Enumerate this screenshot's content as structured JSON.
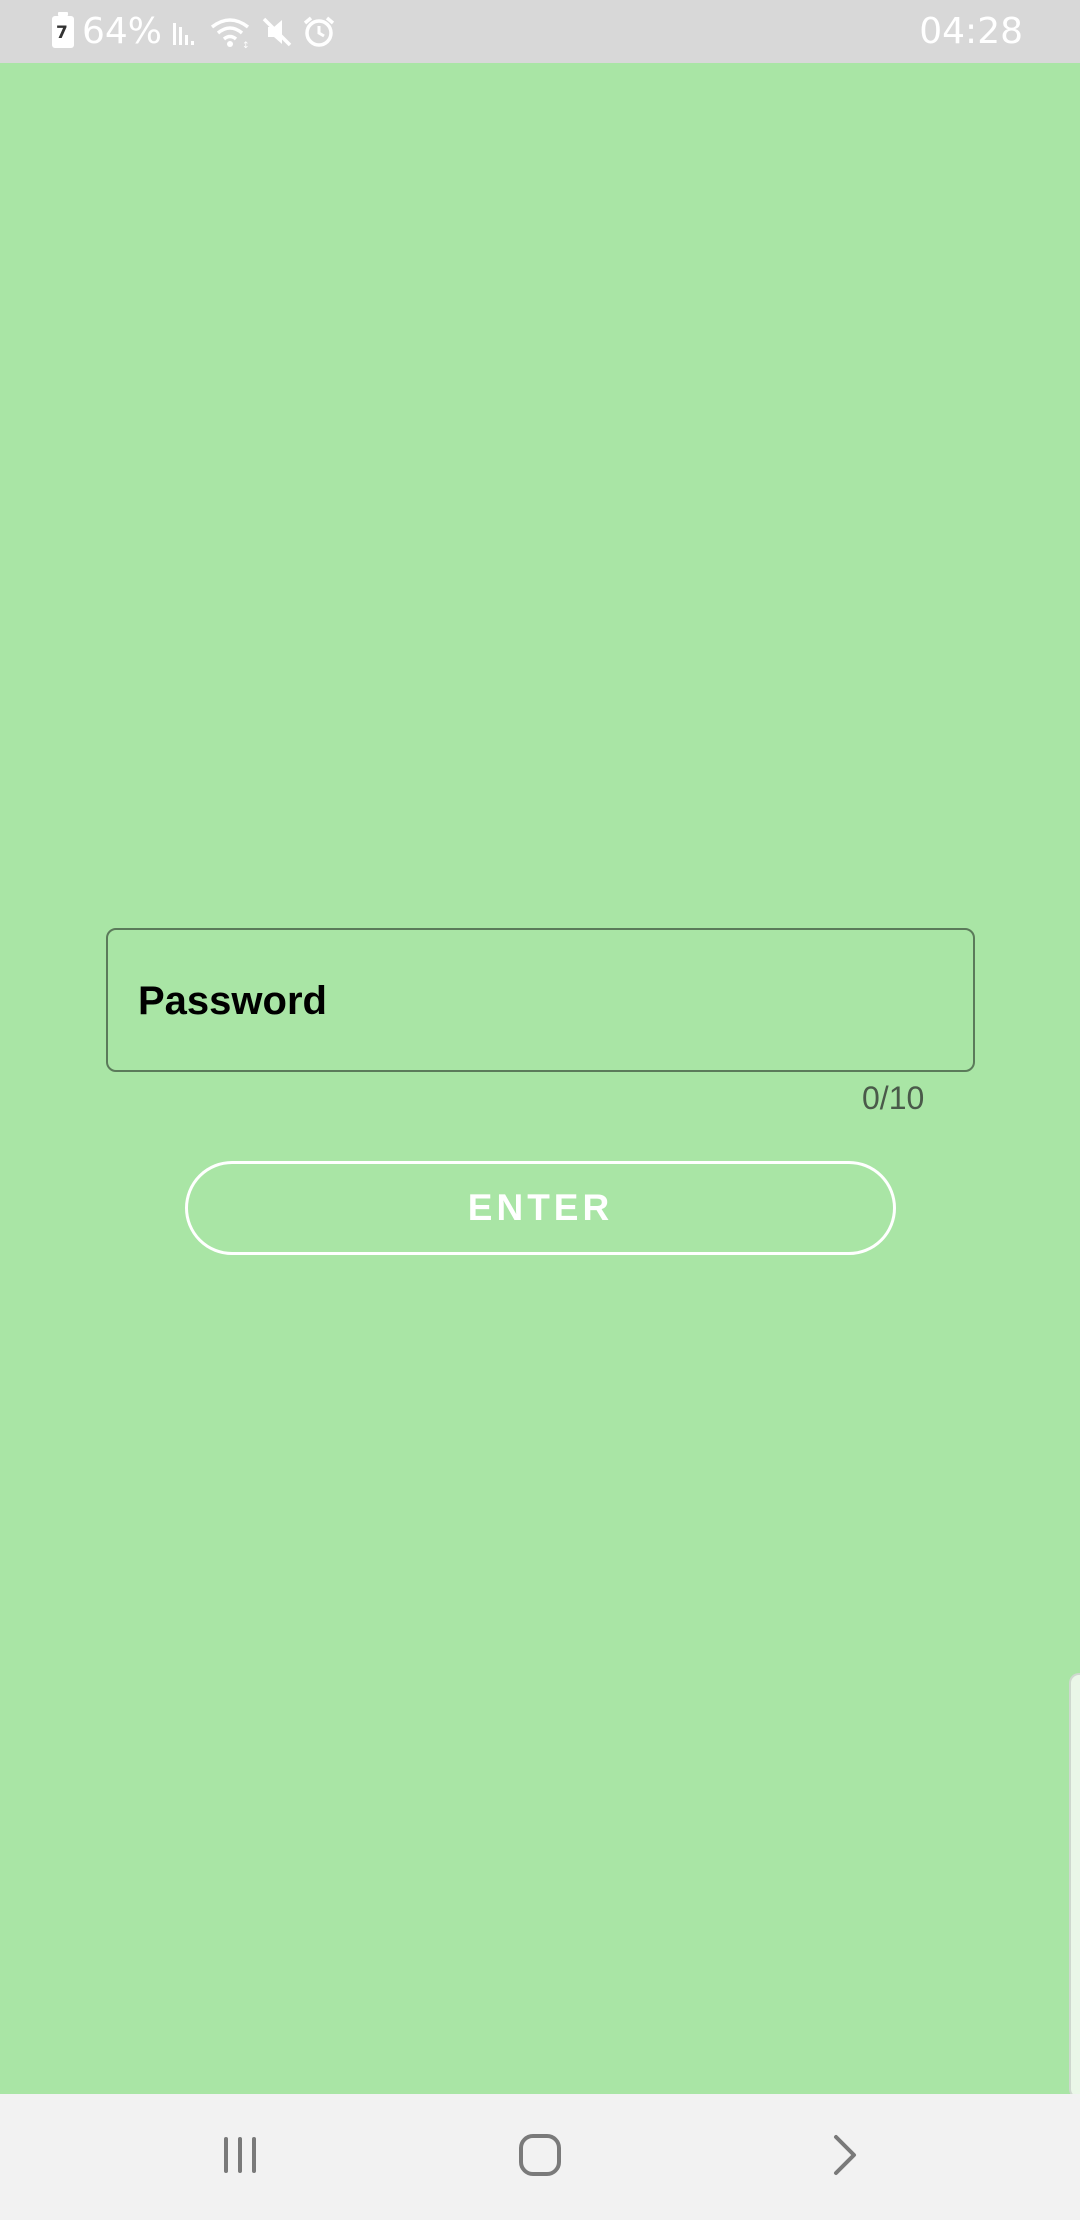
{
  "status_bar": {
    "battery_icon_glyph": "7",
    "battery_percent": "64%",
    "icons": [
      "battery-icon",
      "signal-icon",
      "wifi-icon",
      "mute-icon",
      "alarm-icon"
    ],
    "time": "04:28"
  },
  "login": {
    "password_label": "Password",
    "counter": "0/10",
    "enter_label": "ENTER"
  },
  "nav_bar": {
    "icons": [
      "recents-icon",
      "home-icon",
      "back-icon"
    ]
  },
  "colors": {
    "background": "#a9e5a5",
    "status_bar": "#d8d8d8",
    "nav_bar": "#f2f2f2",
    "field_border": "#5b7a5a",
    "button_border": "#ffffff"
  }
}
